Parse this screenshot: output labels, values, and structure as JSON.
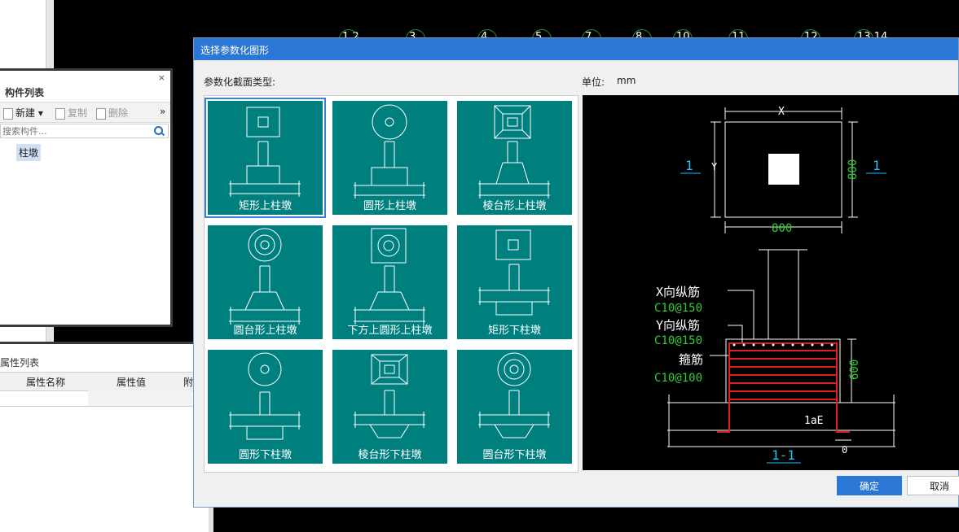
{
  "component_panel": {
    "title": "构件列表",
    "close": "×",
    "toolbar": {
      "new": "新建",
      "copy": "复制",
      "delete": "删除",
      "more": "»"
    },
    "search_placeholder": "搜索构件...",
    "items": [
      "柱墩"
    ]
  },
  "property_panel": {
    "title": "属性列表",
    "columns": [
      "属性名称",
      "属性值",
      "附"
    ]
  },
  "cad_column_numbers": [
    "1,2",
    "3",
    "4",
    "5",
    "7",
    "8",
    "10",
    "11",
    "12",
    "13,14"
  ],
  "dialog": {
    "title": "选择参数化图形",
    "type_label": "参数化截面类型:",
    "unit_label": "单位:",
    "unit_value": "mm",
    "shapes": [
      {
        "label": "矩形上柱墩",
        "selected": true
      },
      {
        "label": "圆形上柱墩"
      },
      {
        "label": "棱台形上柱墩"
      },
      {
        "label": "圆台形上柱墩"
      },
      {
        "label": "下方上圆形上柱墩"
      },
      {
        "label": "矩形下柱墩"
      },
      {
        "label": "圆形下柱墩"
      },
      {
        "label": "棱台形下柱墩"
      },
      {
        "label": "圆台形下柱墩"
      }
    ],
    "preview": {
      "dim_x": "X",
      "dim_y": "Y",
      "dim_800_bottom": "800",
      "dim_800_right": "800",
      "section_mark_left": "1",
      "section_mark_right": "1",
      "x_rebar_label": "X向纵筋",
      "x_rebar_value": "C10@150",
      "y_rebar_label": "Y向纵筋",
      "y_rebar_value": "C10@150",
      "stirrup_label": "箍筋",
      "stirrup_value": "C10@100",
      "dim_600": "600",
      "dim_lae": "1aE",
      "dim_0": "0",
      "section_title": "1-1"
    },
    "ok": "确定",
    "cancel": "取消"
  },
  "colors": {
    "tile": "#007f7f",
    "accent": "#2b77d6",
    "rebar": "#e02020",
    "dim_text_green": "#33cc33",
    "section_cyan": "#20c0ff"
  }
}
